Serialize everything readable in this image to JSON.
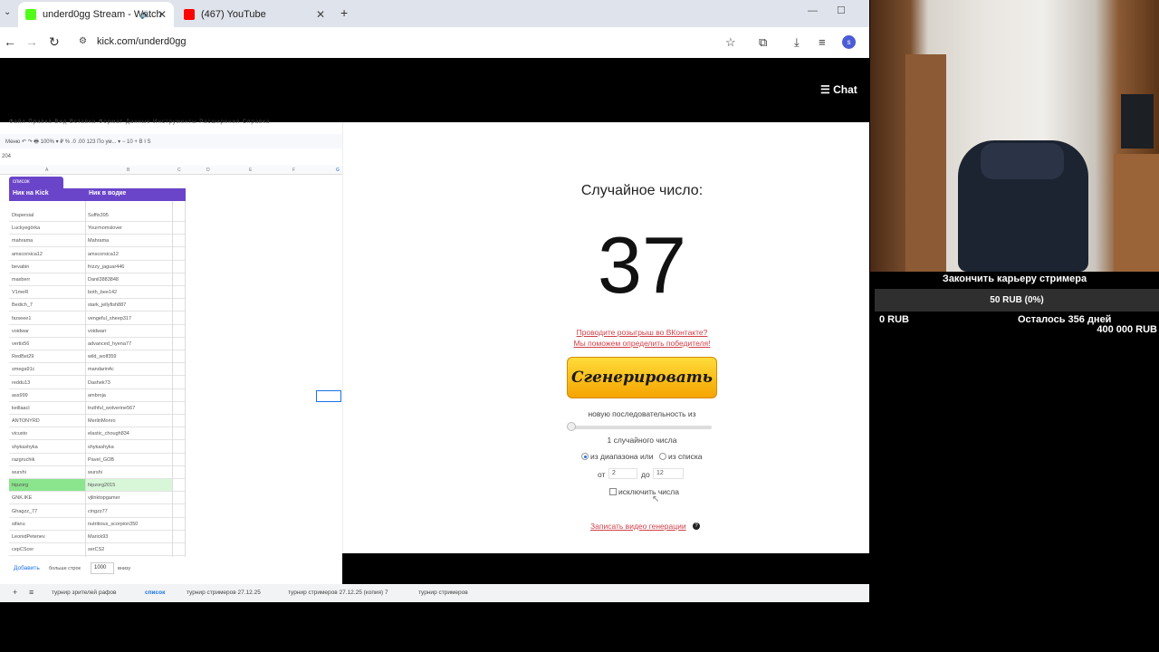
{
  "browser": {
    "tabs": [
      {
        "label": "underd0gg Stream - Watch",
        "favicon_color": "#53fc18"
      },
      {
        "label": "(467) YouTube",
        "favicon_color": "#ff0000"
      }
    ],
    "url": "kick.com/underd0gg",
    "profile_initial": "s"
  },
  "stream": {
    "chat_label": "Chat"
  },
  "sheet": {
    "menu": "Файл  Правка  Вид  Вставка  Формат  Данные  Инструменты  Расширения  Справка",
    "toolbar": "Меню    ↶  ↷  🖶    100%  ▾    ₽   %   .0   .00   123    По ум...  ▾    −  10  +    B   I   S",
    "cell_ref": "204",
    "columns": [
      "A",
      "B",
      "C",
      "D",
      "E",
      "F",
      "G"
    ],
    "filter_tab": "список",
    "headers": [
      "Ник на Kick",
      "Ник в водке"
    ],
    "rows": [
      [
        "Dispersial",
        "Suffix395"
      ],
      [
        "Luckyegōrka",
        "Yourmomslover"
      ],
      [
        "mahrama",
        "Mahrama"
      ],
      [
        "amscorsica12",
        "amscorsica12"
      ],
      [
        "bevabin",
        "frizzy_jaguar446"
      ],
      [
        "maxberr",
        "Danil3883848"
      ],
      [
        "V1meR",
        "both_bee142"
      ],
      [
        "Bedich_7",
        "stark_jellyfish887"
      ],
      [
        "farseee1",
        "vengeful_sheep317"
      ],
      [
        "voidwar",
        "voidwarr"
      ],
      [
        "vertix56",
        "advanced_hyena77"
      ],
      [
        "RedBet29",
        "wild_wolf359"
      ],
      [
        "smega91c",
        "mandarin4c"
      ],
      [
        "reddu13",
        "Dashek73"
      ],
      [
        "ass999",
        "ambroja"
      ],
      [
        "keillaacl",
        "truthful_wolverine567"
      ],
      [
        "ANTONYRD",
        "MerlinMonro"
      ],
      [
        "vicusto",
        "elastic_chough834"
      ],
      [
        "shykashyka",
        "shykashyka"
      ],
      [
        "razgruchik",
        "Pavel_GOB"
      ],
      [
        "wurshi",
        "wurshi"
      ],
      [
        "hipzorg",
        "hipzorg2015"
      ],
      [
        "GNK.IKE",
        "vjlinktopgamer"
      ],
      [
        "Ghagzz_77",
        "cingzz77"
      ],
      [
        "sifanu",
        "nutritious_scorpion350"
      ],
      [
        "LeonidPetenev",
        "Marick93"
      ],
      [
        "cepCScer",
        "serCS2"
      ]
    ],
    "highlighted_row": 21,
    "add_label": "Добавить",
    "more_rows_label": "больше строк",
    "more_rows_value": "1000",
    "more_rows_suffix": "внизу",
    "sheet_tabs": [
      "турнир зрителей рафов",
      "список",
      "турнир стримеров 27.12.25",
      "турнир стримеров 27.12.25 (копия) 7",
      "турнир стримеров"
    ]
  },
  "generator": {
    "title": "Случайное число:",
    "result": "37",
    "promo_line1": "Проводите розыгрыш во ВКонтакте?",
    "promo_line2": "Мы поможем определить победителя!",
    "button_label": "Сгенерировать",
    "sequence_label": "новую последовательность из",
    "count_label": "1 случайного числа",
    "option_range": "из диапазона или",
    "option_list": "из списка",
    "from_label": "от",
    "from_value": "2",
    "to_label": "до",
    "to_value": "12",
    "exclude_label": "исключить числа",
    "record_label": "Записать видео генерации",
    "help_glyph": "?"
  },
  "goal": {
    "title": "Закончить карьеру стримера",
    "progress_text": "50 RUB (0%)",
    "progress_fraction": 0.0,
    "left_amount": "0 RUB",
    "days_left": "Осталось 356 дней",
    "target": "400 000 RUB"
  },
  "icons": [
    "back-icon",
    "forward-icon",
    "reload-icon",
    "site-info-icon",
    "star-icon",
    "extensions-icon",
    "download-icon",
    "media-icon",
    "audio-icon",
    "chat-menu-icon",
    "help-icon"
  ]
}
